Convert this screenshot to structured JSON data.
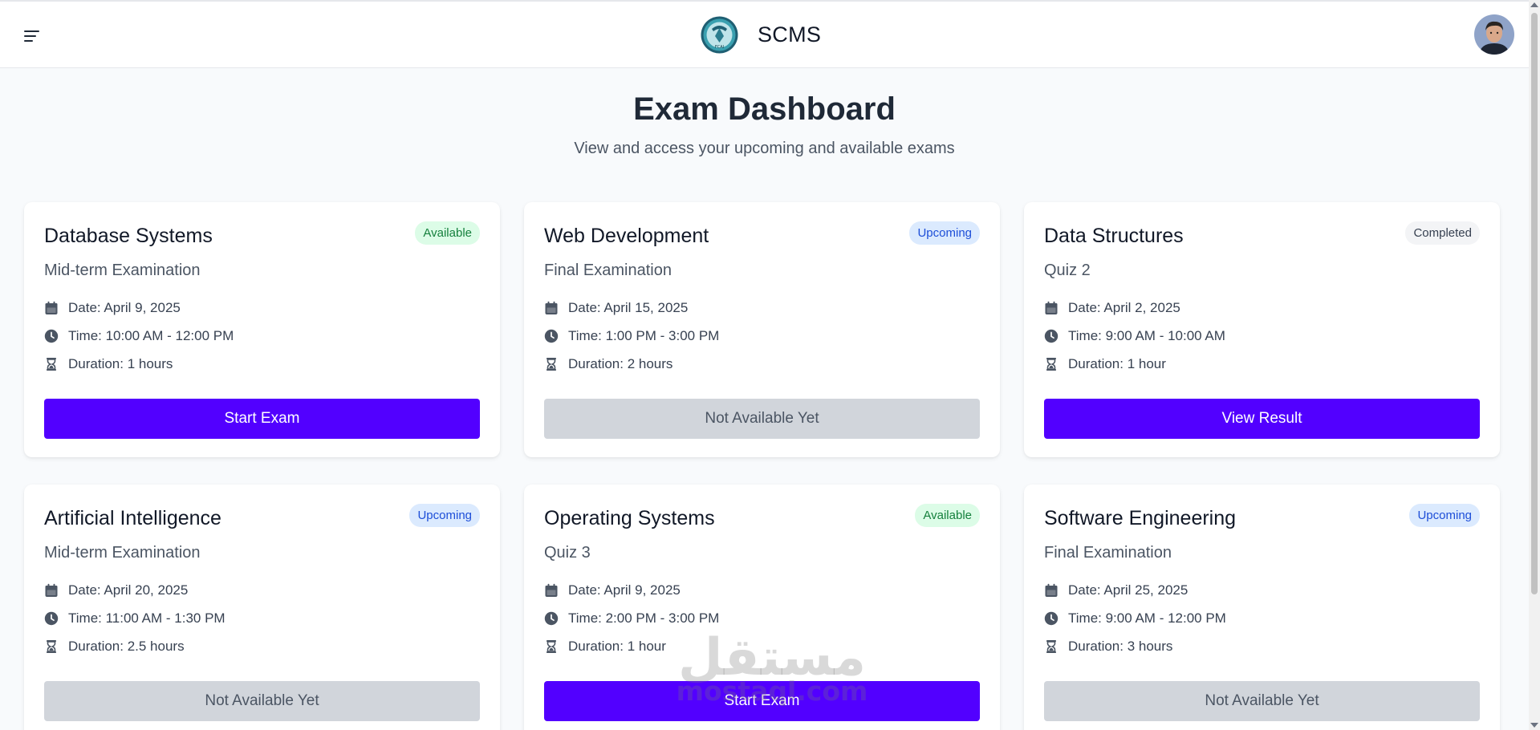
{
  "header": {
    "app_name": "SCMS",
    "logo_text": "FCAI",
    "menu_icon": "menu-icon",
    "avatar_icon": "user-avatar"
  },
  "page": {
    "title": "Exam Dashboard",
    "subtitle": "View and access your upcoming and available exams"
  },
  "colors": {
    "primary": "#5200ff",
    "disabled": "#d1d5db",
    "available_badge_bg": "#dcfce7",
    "upcoming_badge_bg": "#dbeafe",
    "completed_badge_bg": "#f3f4f6"
  },
  "exams": [
    {
      "title": "Database Systems",
      "status": "Available",
      "status_key": "available",
      "type": "Mid-term Examination",
      "date": "Date: April 9, 2025",
      "time": "Time: 10:00 AM - 12:00 PM",
      "duration": "Duration: 1 hours",
      "button": "Start Exam",
      "button_style": "primary"
    },
    {
      "title": "Web Development",
      "status": "Upcoming",
      "status_key": "upcoming",
      "type": "Final Examination",
      "date": "Date: April 15, 2025",
      "time": "Time: 1:00 PM - 3:00 PM",
      "duration": "Duration: 2 hours",
      "button": "Not Available Yet",
      "button_style": "disabled"
    },
    {
      "title": "Data Structures",
      "status": "Completed",
      "status_key": "completed",
      "type": "Quiz 2",
      "date": "Date: April 2, 2025",
      "time": "Time: 9:00 AM - 10:00 AM",
      "duration": "Duration: 1 hour",
      "button": "View Result",
      "button_style": "primary"
    },
    {
      "title": "Artificial Intelligence",
      "status": "Upcoming",
      "status_key": "upcoming",
      "type": "Mid-term Examination",
      "date": "Date: April 20, 2025",
      "time": "Time: 11:00 AM - 1:30 PM",
      "duration": "Duration: 2.5 hours",
      "button": "Not Available Yet",
      "button_style": "disabled"
    },
    {
      "title": "Operating Systems",
      "status": "Available",
      "status_key": "available",
      "type": "Quiz 3",
      "date": "Date: April 9, 2025",
      "time": "Time: 2:00 PM - 3:00 PM",
      "duration": "Duration: 1 hour",
      "button": "Start Exam",
      "button_style": "primary"
    },
    {
      "title": "Software Engineering",
      "status": "Upcoming",
      "status_key": "upcoming",
      "type": "Final Examination",
      "date": "Date: April 25, 2025",
      "time": "Time: 9:00 AM - 12:00 PM",
      "duration": "Duration: 3 hours",
      "button": "Not Available Yet",
      "button_style": "disabled"
    }
  ],
  "watermark": {
    "arabic": "مستقل",
    "latin": "mostaql.com"
  }
}
